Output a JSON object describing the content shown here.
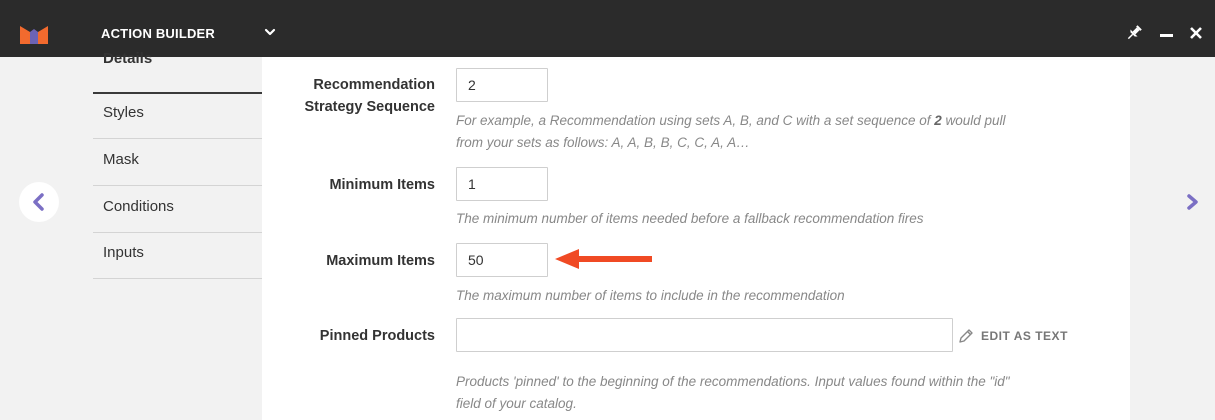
{
  "header": {
    "app_title": "ACTION BUILDER",
    "colors": {
      "bar": "#2b2b2b",
      "logo_orange": "#f26a2e",
      "logo_purple": "#6c63b5"
    }
  },
  "sidebar": {
    "items": [
      {
        "label": "Details",
        "active": true
      },
      {
        "label": "Styles",
        "active": false
      },
      {
        "label": "Mask",
        "active": false
      },
      {
        "label": "Conditions",
        "active": false
      },
      {
        "label": "Inputs",
        "active": false
      }
    ]
  },
  "form": {
    "strategy_sequence": {
      "label_line1": "Recommendation",
      "label_line2": "Strategy Sequence",
      "value": "2",
      "help_before": "For example, a Recommendation using sets A, B, and C with a set sequence of ",
      "help_bold": "2",
      "help_after": " would pull",
      "help_line2": "from your sets as follows: A, A, B, B, C, C, A, A…"
    },
    "minimum_items": {
      "label": "Minimum Items",
      "value": "1",
      "help": "The minimum number of items needed before a fallback recommendation fires"
    },
    "maximum_items": {
      "label": "Maximum Items",
      "value": "50",
      "help": "The maximum number of items to include in the recommendation"
    },
    "pinned_products": {
      "label": "Pinned Products",
      "value": "",
      "edit_as_text": "EDIT AS TEXT",
      "help_line1": "Products 'pinned' to the beginning of the recommendations. Input values found within the \"id\"",
      "help_line2": "field of your catalog."
    }
  },
  "icons": {
    "logo": "brand-logo-icon",
    "title_dropdown": "chevron-down-icon",
    "pin": "pin-icon",
    "minimize": "minimize-icon",
    "close": "close-icon",
    "prev": "chevron-left-icon",
    "next": "chevron-right-icon",
    "edit": "pencil-icon",
    "annotation": "red-arrow-icon"
  },
  "accent_colors": {
    "nav_arrow": "#7b6fc4",
    "annotation_arrow": "#f04a24"
  }
}
